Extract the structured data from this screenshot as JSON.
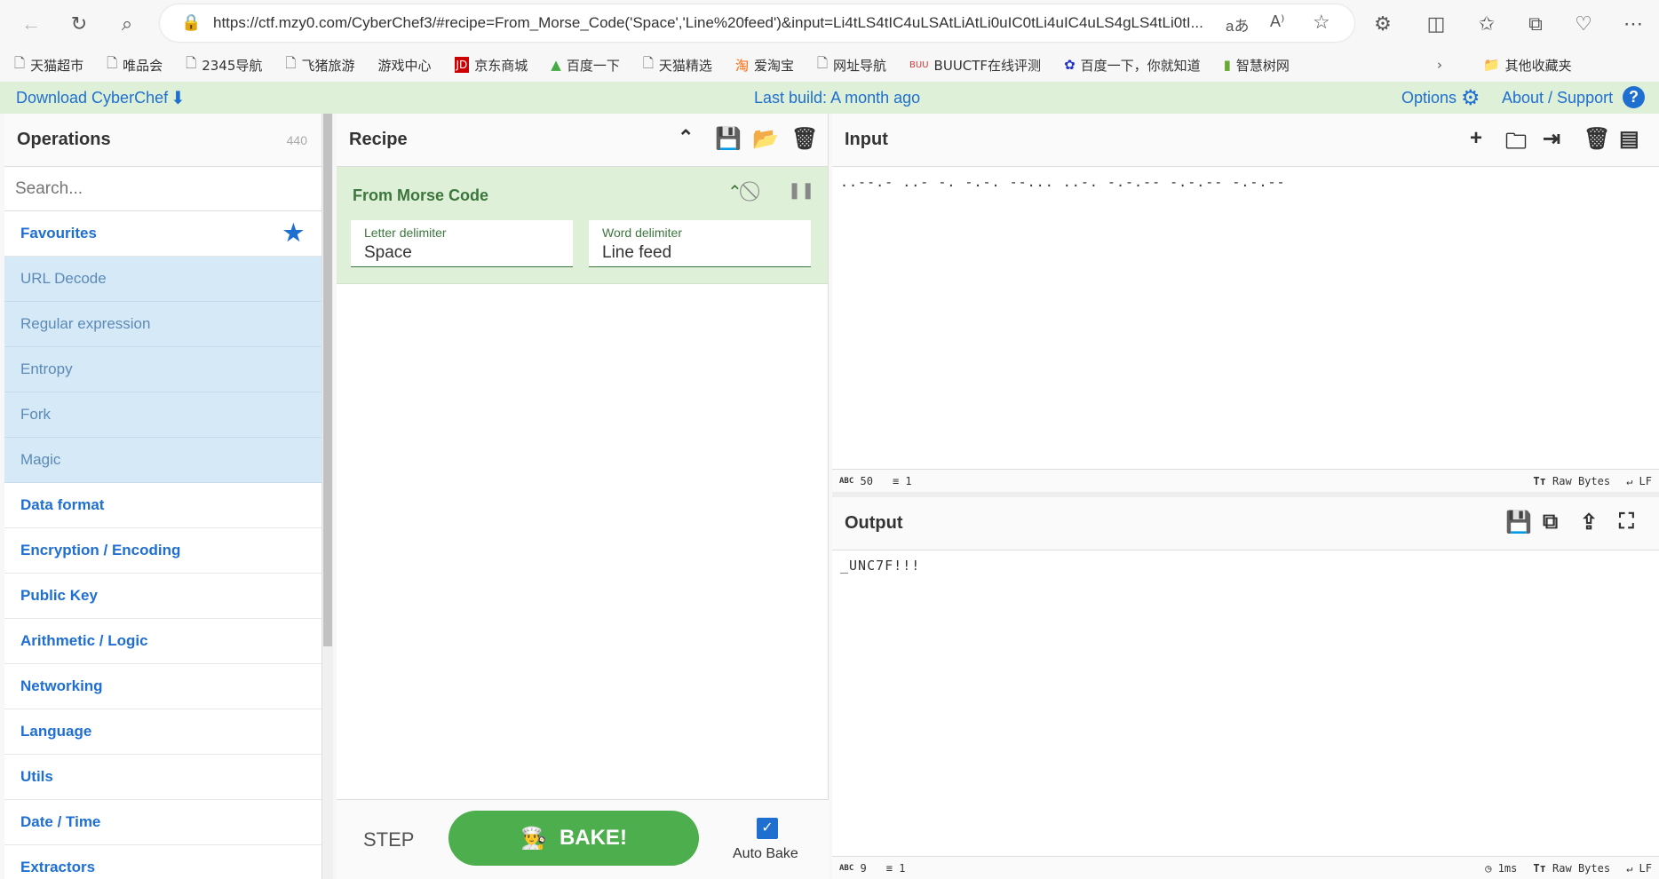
{
  "browser": {
    "url": "https://ctf.mzy0.com/CyberChef3/#recipe=From_Morse_Code('Space','Line%20feed')&input=Li4tLS4tIC4uLSAtLiAtLi0uIC0tLi4uIC4uLS4gLS4tLi0tI..."
  },
  "bookmarks": [
    "天猫超市",
    "唯品会",
    "2345导航",
    "飞猪旅游",
    "游戏中心",
    "京东商城",
    "百度一下",
    "天猫精选",
    "爱淘宝",
    "网址导航",
    "BUUCTF在线评测",
    "百度一下，你就知道",
    "智慧树网"
  ],
  "bookmarks_other": "其他收藏夹",
  "header": {
    "download": "Download CyberChef",
    "build": "Last build: A month ago",
    "options": "Options",
    "about": "About / Support"
  },
  "operations": {
    "title": "Operations",
    "count": "440",
    "search_placeholder": "Search...",
    "favourites": "Favourites",
    "fav_items": [
      "URL Decode",
      "Regular expression",
      "Entropy",
      "Fork",
      "Magic"
    ],
    "categories": [
      "Data format",
      "Encryption / Encoding",
      "Public Key",
      "Arithmetic / Logic",
      "Networking",
      "Language",
      "Utils",
      "Date / Time",
      "Extractors"
    ]
  },
  "recipe": {
    "title": "Recipe",
    "op_name": "From Morse Code",
    "letter_label": "Letter delimiter",
    "letter_value": "Space",
    "word_label": "Word delimiter",
    "word_value": "Line feed",
    "step": "STEP",
    "bake": "BAKE!",
    "autobake": "Auto Bake",
    "autobake_checked": true
  },
  "input": {
    "title": "Input",
    "value": "..--.- ..- -. -.-. --... ..-. -.-.-- -.-.-- -.-.--",
    "length": "50",
    "lines": "1",
    "encoding": "Raw Bytes",
    "eol": "LF"
  },
  "output": {
    "title": "Output",
    "value": "_UNC7F!!!",
    "length": "9",
    "lines": "1",
    "time": "1ms",
    "encoding": "Raw Bytes",
    "eol": "LF"
  },
  "colors": {
    "accent": "#1f6fd0",
    "green_header": "#dff0d8",
    "bake": "#4cae4c",
    "recipe_op": "#dff0d8"
  }
}
